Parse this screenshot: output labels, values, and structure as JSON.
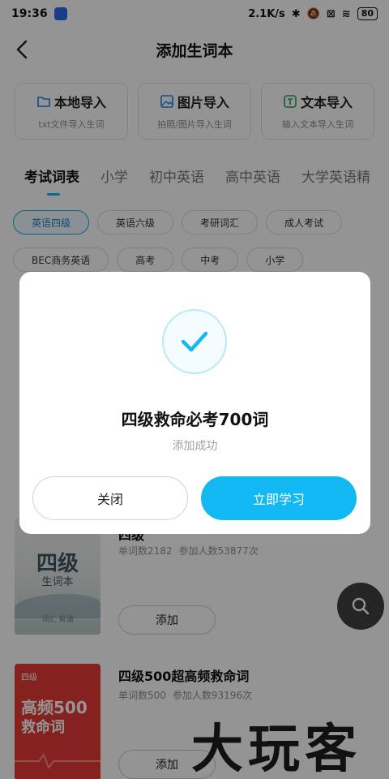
{
  "status_bar": {
    "time": "19:36",
    "network_speed": "2.1K/s",
    "battery": "80"
  },
  "header": {
    "title": "添加生词本"
  },
  "imports": [
    {
      "label": "本地导入",
      "desc": "txt文件导入生词",
      "icon": "folder-icon",
      "color": "#1e88e5"
    },
    {
      "label": "图片导入",
      "desc": "拍照/图片导入生词",
      "icon": "image-icon",
      "color": "#1e88e5"
    },
    {
      "label": "文本导入",
      "desc": "输入文本导入生词",
      "icon": "text-icon",
      "color": "#2e9d5b"
    }
  ],
  "tabs": [
    "考试词表",
    "小学",
    "初中英语",
    "高中英语",
    "大学英语精"
  ],
  "chips_row1": [
    "英语四级",
    "英语六级",
    "考研词汇",
    "成人考试"
  ],
  "chips_row2": [
    "BEC商务英语",
    "高考",
    "中考",
    "小学"
  ],
  "list": {
    "item1": {
      "cover_title": "四级",
      "cover_sub": "生词本",
      "cover_foot": "词汇\n背诵",
      "title_partial": "四级",
      "stats_words": "单词数2182",
      "stats_people": "参加人数53877次",
      "add_label": "添加"
    },
    "item2": {
      "cover_tag": "四级",
      "cover_line1": "高频500",
      "cover_line2": "救命词",
      "title": "四级500超高频救命词",
      "stats_words": "单词数500",
      "stats_people": "参加人数93196次",
      "add_label": "添加"
    }
  },
  "modal": {
    "title": "四级救命必考700词",
    "subtitle": "添加成功",
    "close_label": "关闭",
    "study_label": "立即学习",
    "accent": "#12b8f2"
  },
  "watermark": "大玩客"
}
